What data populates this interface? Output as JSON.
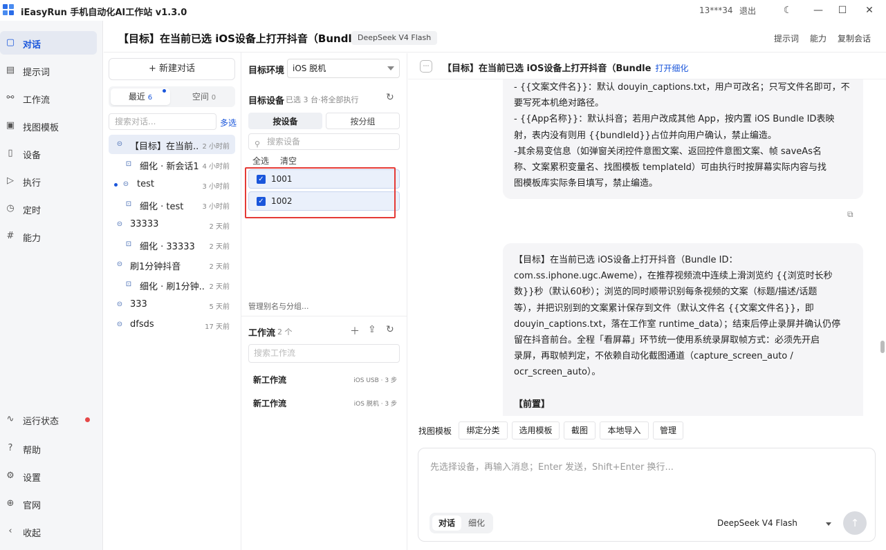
{
  "app": {
    "title": "iEasyRun 手机自动化AI工作站 v1.3.0",
    "user": "13***34",
    "logout": "退出"
  },
  "sidebar": {
    "items": [
      {
        "label": "对话",
        "icon": "chat-icon"
      },
      {
        "label": "提示词",
        "icon": "document-icon"
      },
      {
        "label": "工作流",
        "icon": "workflow-icon"
      },
      {
        "label": "找图模板",
        "icon": "image-icon"
      },
      {
        "label": "设备",
        "icon": "phone-icon"
      },
      {
        "label": "执行",
        "icon": "play-icon"
      },
      {
        "label": "定时",
        "icon": "clock-icon"
      },
      {
        "label": "能力",
        "icon": "hash-icon"
      }
    ],
    "bottom": [
      {
        "label": "运行状态",
        "icon": "pulse-icon"
      },
      {
        "label": "帮助",
        "icon": "help-icon"
      },
      {
        "label": "设置",
        "icon": "gear-icon"
      },
      {
        "label": "官网",
        "icon": "globe-icon"
      },
      {
        "label": "收起",
        "icon": "chevron-left-icon"
      }
    ],
    "status_color": "#e54848"
  },
  "header": {
    "title": "【目标】在当前已选 iOS设备上打开抖音（Bundle",
    "model_badge": "DeepSeek V4 Flash",
    "links": [
      "提示词",
      "能力",
      "复制会话"
    ]
  },
  "conversations": {
    "new_button": "+ 新建对话",
    "tab_recent": "最近",
    "tab_recent_count": "6",
    "tab_space": "空间",
    "tab_space_count": "0",
    "search_placeholder": "搜索对话...",
    "multi_select": "多选",
    "items": [
      {
        "title": "【目标】在当前...",
        "time": "2 小时前",
        "sub": false,
        "active": true
      },
      {
        "title": "细化 · 新会话1",
        "time": "4 小时前",
        "sub": true
      },
      {
        "title": "test",
        "time": "3 小时前",
        "sub": false,
        "unread": true
      },
      {
        "title": "细化 · test",
        "time": "3 小时前",
        "sub": true
      },
      {
        "title": "33333",
        "time": "2 天前",
        "sub": false
      },
      {
        "title": "细化 · 33333",
        "time": "2 天前",
        "sub": true
      },
      {
        "title": "刷1分钟抖音",
        "time": "2 天前",
        "sub": false
      },
      {
        "title": "细化 · 刷1分钟...",
        "time": "2 天前",
        "sub": true
      },
      {
        "title": "333",
        "time": "5 天前",
        "sub": false
      },
      {
        "title": "dfsds",
        "time": "17 天前",
        "sub": false
      }
    ]
  },
  "devices": {
    "env_label": "目标环境",
    "env_value": "iOS 脱机",
    "target_label": "目标设备",
    "target_hint": "已选 3 台·将全部执行",
    "tab_by_device": "按设备",
    "tab_by_group": "按分组",
    "search_placeholder": "搜索设备",
    "select_all": "全选",
    "clear": "清空",
    "list": [
      {
        "name": "1001",
        "checked": true
      },
      {
        "name": "1002",
        "checked": true
      }
    ],
    "manage": "管理别名与分组..."
  },
  "workflows": {
    "label": "工作流",
    "count": "2 个",
    "search_placeholder": "搜索工作流",
    "items": [
      {
        "name": "新工作流",
        "meta": "iOS USB · 3 步"
      },
      {
        "name": "新工作流",
        "meta": "iOS 脱机 · 3 步"
      }
    ]
  },
  "chat": {
    "title": "【目标】在当前已选 iOS设备上打开抖音（Bundle",
    "open_refine": "打开细化",
    "msg1": [
      "- {{文案文件名}}：默认 douyin_captions.txt，用户可改名；只写文件名即可，不",
      "要写死本机绝对路径。",
      "- {{App名称}}：默认抖音；若用户改成其他 App，按内置 iOS Bundle ID表映",
      "射，表内没有则用 {{bundleId}}占位并向用户确认，禁止编造。",
      "-其余易变信息（如弹窗关闭控件意图文案、返回控件意图文案、帧 saveAs名",
      "称、文案累积变量名、找图模板 templateId）可由执行时按屏幕实际内容与找",
      "图模板库实际条目填写，禁止编造。"
    ],
    "msg2": [
      "【目标】在当前已选 iOS设备上打开抖音（Bundle ID：",
      "com.ss.iphone.ugc.Aweme），在推荐视频流中连续上滑浏览约 {{浏览时长秒",
      "数}}秒（默认60秒）；浏览的同时顺带识别每条视频的文案（标题/描述/话题",
      "等），并把识别到的文案累计保存到文件（默认文件名 {{文案文件名}}，即",
      "douyin_captions.txt，落在工作室 runtime_data）；结束后停止录屏并确认仍停",
      "留在抖音前台。全程「看屏幕」环节统一使用系统录屏取帧方式：必须先开启",
      "录屏，再取帧判定，不依赖自动化截图通道（capture_screen_auto /",
      "ocr_screen_auto）。",
      "",
      "【前置】"
    ]
  },
  "toolbar": {
    "label": "找图模板",
    "buttons": [
      "绑定分类",
      "选用模板",
      "截图",
      "本地导入",
      "管理"
    ]
  },
  "composer": {
    "placeholder": "先选择设备，再输入消息；Enter 发送，Shift+Enter 换行...",
    "mode_chat": "对话",
    "mode_refine": "细化",
    "model": "DeepSeek V4 Flash"
  },
  "colors": {
    "accent": "#1a56db",
    "highlight": "#e53935"
  }
}
